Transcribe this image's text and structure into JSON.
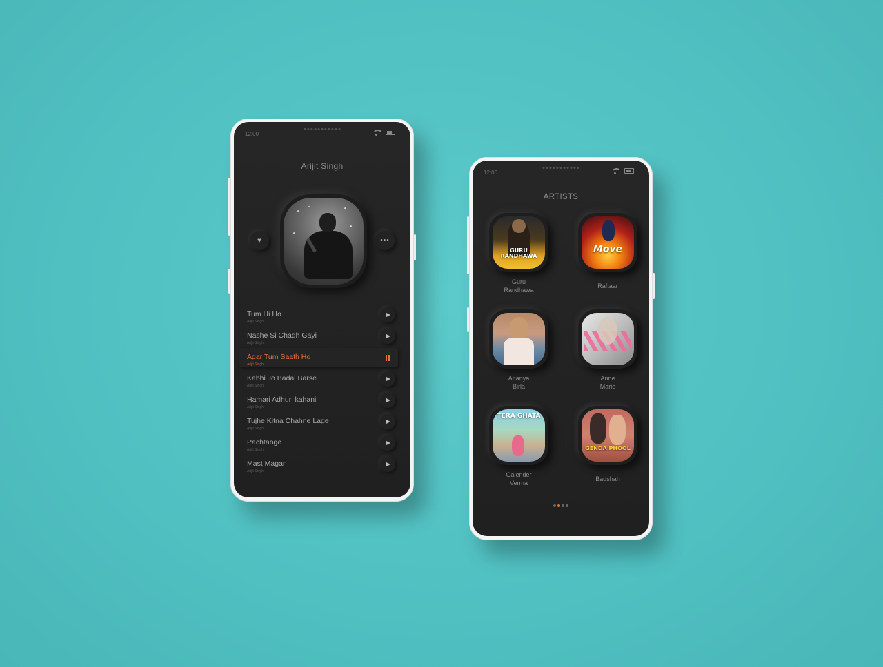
{
  "colors": {
    "background": "#52c2c3",
    "screen": "#242424",
    "accent": "#e9703c",
    "text": "#a8a8a8"
  },
  "player": {
    "status_time": "12:00",
    "artist_name": "Arijit Singh",
    "like_icon": "heart-icon",
    "more_icon": "more-dots-icon",
    "tracks": [
      {
        "title": "Tum Hi Ho",
        "subtitle": "Arijit Singh",
        "active": false
      },
      {
        "title": "Nashe Si Chadh  Gayi",
        "subtitle": "Arijit Singh",
        "active": false
      },
      {
        "title": "Agar Tum Saath Ho",
        "subtitle": "Arijit Singh",
        "active": true
      },
      {
        "title": "Kabhi Jo Badal Barse",
        "subtitle": "Arijit Singh",
        "active": false
      },
      {
        "title": "Hamari Adhuri kahani",
        "subtitle": "Arijit Singh",
        "active": false
      },
      {
        "title": "Tujhe Kitna Chahne Lage",
        "subtitle": "Arijit Singh",
        "active": false
      },
      {
        "title": "Pachtaoge",
        "subtitle": "Arijit Singh",
        "active": false
      },
      {
        "title": "Mast Magan",
        "subtitle": "Arijit Singh",
        "active": false
      }
    ]
  },
  "artists_screen": {
    "status_time": "12:00",
    "title": "ARTISTS",
    "artists": [
      {
        "name": "Guru\nRandhawa",
        "art_text": "GURU RANDHAWA"
      },
      {
        "name": "Raftaar",
        "art_text": "Move"
      },
      {
        "name": "Ananya\nBirla",
        "art_text": ""
      },
      {
        "name": "Anne\nMarie",
        "art_text": ""
      },
      {
        "name": "Gajender\nVerma",
        "art_text": "TERA GHATA"
      },
      {
        "name": "Badshah",
        "art_text": "GENDA PHOOL"
      }
    ],
    "page_dots": 4,
    "active_dot": 1
  }
}
